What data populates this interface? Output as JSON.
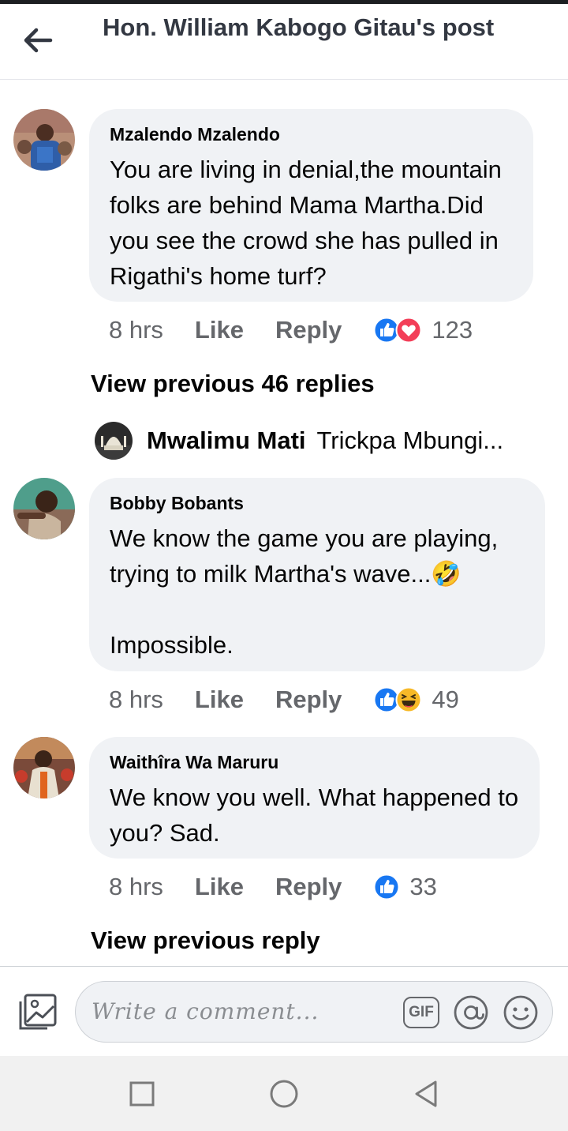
{
  "header": {
    "title": "Hon. William Kabogo Gitau's post",
    "back_icon": "arrow-left-icon"
  },
  "comments": [
    {
      "author": "Mzalendo Mzalendo",
      "text": "You are living in denial,the mountain folks are behind Mama Martha.Did you see the crowd she has pulled in Rigathi's home turf?",
      "time": "8 hrs",
      "like_label": "Like",
      "reply_label": "Reply",
      "reactions": [
        "like-reaction-icon",
        "love-reaction-icon"
      ],
      "reaction_count": "123"
    },
    {
      "author": "Bobby Bobants",
      "text_line1": "We know the game you are playing, trying to milk Martha's wave...",
      "text_line2": "Impossible.",
      "emoji": "🤣",
      "time": "8 hrs",
      "like_label": "Like",
      "reply_label": "Reply",
      "reactions": [
        "like-reaction-icon",
        "haha-reaction-icon"
      ],
      "reaction_count": "49"
    },
    {
      "author": "Waithîra Wa Maruru",
      "text": "We know you well. What happened to you? Sad.",
      "time": "8 hrs",
      "like_label": "Like",
      "reply_label": "Reply",
      "reactions": [
        "like-reaction-icon"
      ],
      "reaction_count": "33"
    }
  ],
  "view_previous_1": "View previous 46 replies",
  "nested_reply": {
    "name": "Mwalimu Mati",
    "snippet": "Trickpa Mbungi..."
  },
  "view_previous_2": "View previous reply",
  "composer": {
    "placeholder": "Write a comment...",
    "gif_label": "GIF",
    "icons": [
      "photo-icon",
      "gif-icon",
      "at-icon",
      "emoji-icon"
    ]
  },
  "colors": {
    "bubble": "#f0f2f5",
    "like_blue": "#1877f2",
    "love_red": "#f33e58",
    "haha_yellow": "#f7b928",
    "muted_text": "#65676b"
  }
}
